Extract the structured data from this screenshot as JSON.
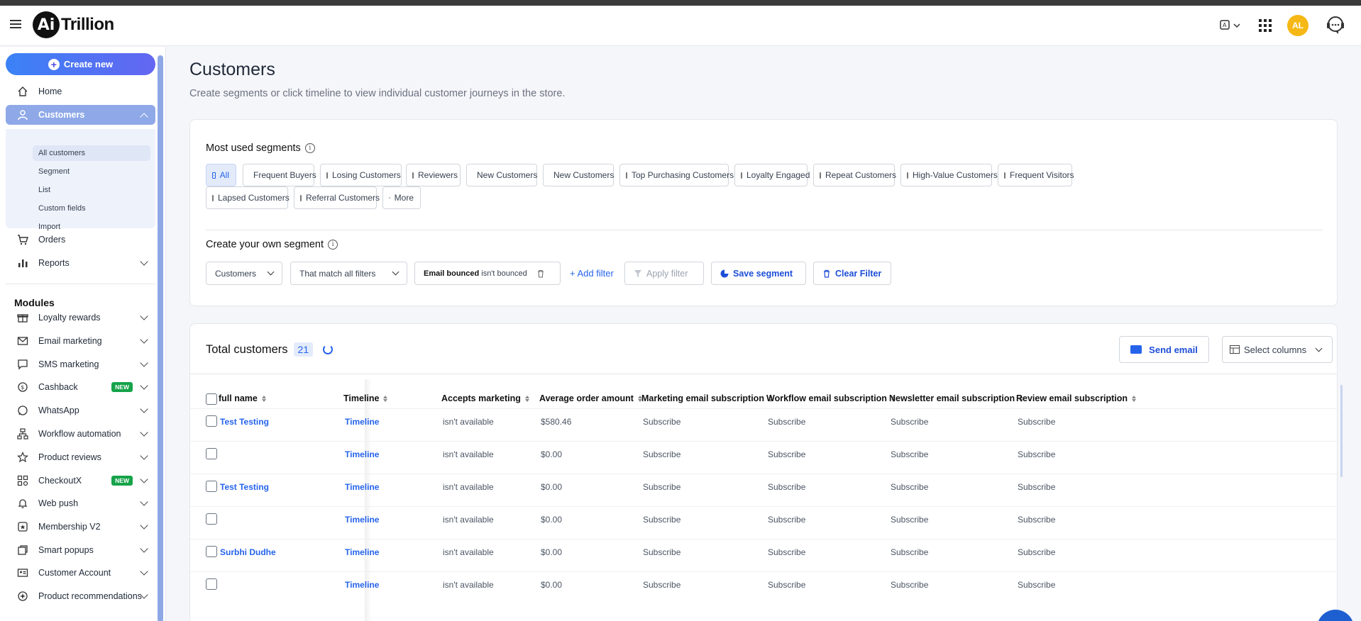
{
  "header": {
    "logo_mark": "Ai",
    "logo_text": "Trillion",
    "avatar_initials": "AL"
  },
  "sidebar": {
    "create_label": "Create new",
    "items": {
      "home": "Home",
      "customers": "Customers",
      "orders": "Orders",
      "reports": "Reports"
    },
    "customers_sub": [
      "All customers",
      "Segment",
      "List",
      "Custom fields",
      "Import"
    ],
    "modules_title": "Modules",
    "modules": [
      {
        "label": "Loyalty rewards",
        "icon": "gift-icon",
        "badge": ""
      },
      {
        "label": "Email marketing",
        "icon": "mail-icon",
        "badge": ""
      },
      {
        "label": "SMS marketing",
        "icon": "chat-icon",
        "badge": ""
      },
      {
        "label": "Cashback",
        "icon": "cashback-icon",
        "badge": "NEW"
      },
      {
        "label": "WhatsApp",
        "icon": "whatsapp-icon",
        "badge": ""
      },
      {
        "label": "Workflow automation",
        "icon": "workflow-icon",
        "badge": ""
      },
      {
        "label": "Product reviews",
        "icon": "star-icon",
        "badge": ""
      },
      {
        "label": "CheckoutX",
        "icon": "checkout-icon",
        "badge": "NEW"
      },
      {
        "label": "Web push",
        "icon": "bell-icon",
        "badge": ""
      },
      {
        "label": "Membership V2",
        "icon": "membership-icon",
        "badge": ""
      },
      {
        "label": "Smart popups",
        "icon": "popup-icon",
        "badge": ""
      },
      {
        "label": "Customer Account",
        "icon": "id-card-icon",
        "badge": ""
      },
      {
        "label": "Product recommendations",
        "icon": "recommend-icon",
        "badge": ""
      }
    ]
  },
  "page": {
    "title": "Customers",
    "subtitle": "Create segments or click timeline to view individual customer journeys in the store."
  },
  "segments": {
    "title": "Most used segments",
    "chips": [
      "All",
      "Frequent Buyers",
      "Losing Customers",
      "Reviewers",
      "New Customers",
      "New Customers",
      "Top Purchasing Customers",
      "Loyalty Engaged",
      "Repeat Customers",
      "High-Value Customers",
      "Frequent Visitors",
      "Lapsed Customers",
      "Referral Customers",
      "More"
    ],
    "own_title": "Create your own segment",
    "dd_entity": "Customers",
    "dd_match": "That match all filters",
    "filter_field": "Email bounced",
    "filter_value": "isn't bounced",
    "add_filter": "+ Add filter",
    "apply_filter": "Apply filter",
    "save_segment": "Save segment",
    "clear_filter": "Clear Filter"
  },
  "table": {
    "title": "Total customers",
    "count": "21",
    "send_email": "Send email",
    "select_columns": "Select columns",
    "columns": [
      "full name",
      "Timeline",
      "Accepts marketing",
      "Average order amount",
      "Marketing email subscription",
      "Workflow email subscription",
      "Newsletter email subscription",
      "Review email subscription"
    ],
    "rows": [
      {
        "name": "Test Testing",
        "timeline": "Timeline",
        "accepts": "isn't available",
        "avg": "$580.46",
        "mkt": "Subscribe",
        "wf": "Subscribe",
        "news": "Subscribe",
        "rev": "Subscribe"
      },
      {
        "name": "",
        "timeline": "Timeline",
        "accepts": "isn't available",
        "avg": "$0.00",
        "mkt": "Subscribe",
        "wf": "Subscribe",
        "news": "Subscribe",
        "rev": "Subscribe"
      },
      {
        "name": "Test Testing",
        "timeline": "Timeline",
        "accepts": "isn't available",
        "avg": "$0.00",
        "mkt": "Subscribe",
        "wf": "Subscribe",
        "news": "Subscribe",
        "rev": "Subscribe"
      },
      {
        "name": "",
        "timeline": "Timeline",
        "accepts": "isn't available",
        "avg": "$0.00",
        "mkt": "Subscribe",
        "wf": "Subscribe",
        "news": "Subscribe",
        "rev": "Subscribe"
      },
      {
        "name": "Surbhi Dudhe",
        "timeline": "Timeline",
        "accepts": "isn't available",
        "avg": "$0.00",
        "mkt": "Subscribe",
        "wf": "Subscribe",
        "news": "Subscribe",
        "rev": "Subscribe"
      },
      {
        "name": "",
        "timeline": "Timeline",
        "accepts": "isn't available",
        "avg": "$0.00",
        "mkt": "Subscribe",
        "wf": "Subscribe",
        "news": "Subscribe",
        "rev": "Subscribe"
      }
    ]
  },
  "colors": {
    "accent": "#2563eb",
    "active_nav": "#8fa9e8",
    "new_badge": "#16a34a",
    "avatar": "#f5b815"
  }
}
